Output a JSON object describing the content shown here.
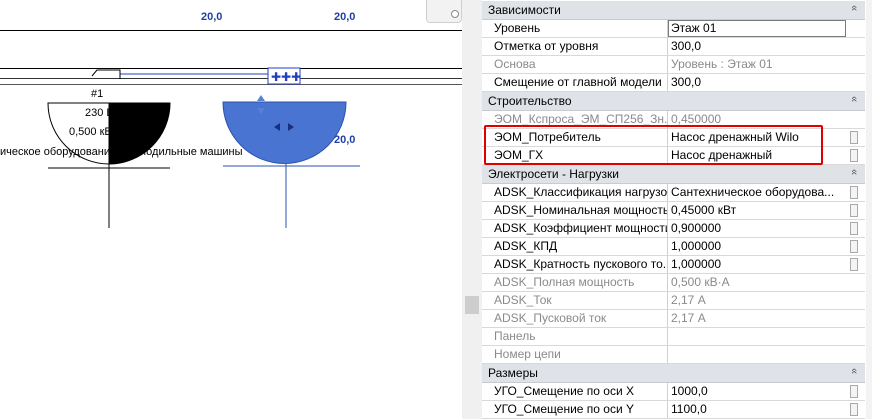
{
  "canvas": {
    "dim_left": "20,0",
    "dim_right": "20,0",
    "dim_small": "20,0",
    "tag_number": "#1",
    "tag_voltage": "230 В",
    "tag_power": "0,500 кВ·А",
    "tag_category": "ическое оборудование и холодильные машины"
  },
  "properties": {
    "groups": [
      {
        "title": "Зависимости",
        "rows": [
          {
            "name": "Уровень",
            "value": "Этаж 01",
            "disabled": false,
            "boxed": true
          },
          {
            "name": "Отметка от уровня",
            "value": "300,0",
            "disabled": false
          },
          {
            "name": "Основа",
            "value": "Уровень : Этаж 01",
            "disabled": true
          },
          {
            "name": "Смещение от главной модели",
            "value": "300,0",
            "disabled": false
          }
        ]
      },
      {
        "title": "Строительство",
        "rows": [
          {
            "name": "ЭОМ_Кспроса_ЭМ_СП256_Зн...",
            "value": "0,450000",
            "disabled": true
          },
          {
            "name": "ЭОМ_Потребитель",
            "value": "Насос дренажный Wilo",
            "disabled": false
          },
          {
            "name": "ЭОМ_ГХ",
            "value": "Насос дренажный",
            "disabled": false
          }
        ]
      },
      {
        "title": "Электросети - Нагрузки",
        "rows": [
          {
            "name": "ADSK_Классификация нагрузок",
            "value": "Сантехническое оборудова...",
            "disabled": false
          },
          {
            "name": "ADSK_Номинальная мощность",
            "value": "0,45000 кВт",
            "disabled": false
          },
          {
            "name": "ADSK_Коэффициент мощности",
            "value": "0,900000",
            "disabled": false
          },
          {
            "name": "ADSK_КПД",
            "value": "1,000000",
            "disabled": false
          },
          {
            "name": "ADSK_Кратность пускового то...",
            "value": "1,000000",
            "disabled": false
          },
          {
            "name": "ADSK_Полная мощность",
            "value": "0,500 кВ·А",
            "disabled": true
          },
          {
            "name": "ADSK_Ток",
            "value": "2,17 А",
            "disabled": true
          },
          {
            "name": "ADSK_Пусковой ток",
            "value": "2,17 А",
            "disabled": true
          },
          {
            "name": "Панель",
            "value": "",
            "disabled": true
          },
          {
            "name": "Номер цепи",
            "value": "",
            "disabled": true
          }
        ]
      },
      {
        "title": "Размеры",
        "rows": [
          {
            "name": "УГО_Смещение по оси X",
            "value": "1000,0",
            "disabled": false
          },
          {
            "name": "УГО_Смещение по оси Y",
            "value": "1100,0",
            "disabled": false
          }
        ]
      }
    ]
  },
  "colors": {
    "highlight": "#e00000",
    "selected_symbol": "#4a74d1",
    "dimension_text": "#1f3fa6"
  }
}
